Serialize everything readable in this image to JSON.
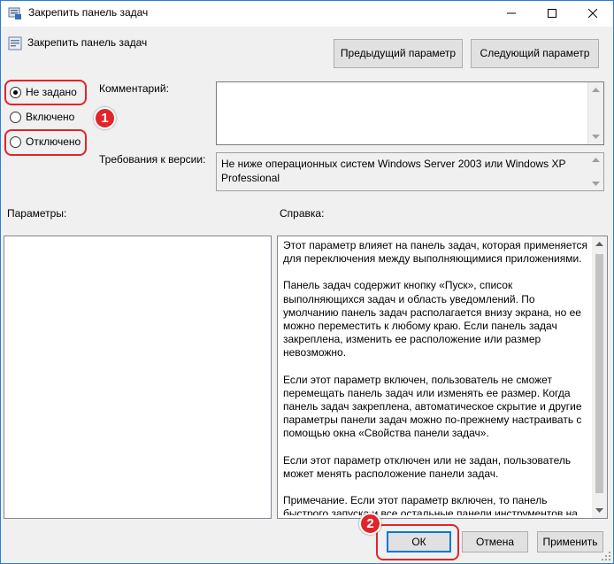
{
  "window": {
    "title": "Закрепить панель задач"
  },
  "header": {
    "policy_name": "Закрепить панель задач",
    "prev_button": "Предыдущий параметр",
    "next_button": "Следующий параметр"
  },
  "state_options": [
    {
      "label": "Не задано",
      "selected": true
    },
    {
      "label": "Включено",
      "selected": false
    },
    {
      "label": "Отключено",
      "selected": false
    }
  ],
  "comment": {
    "label": "Комментарий:",
    "value": ""
  },
  "version": {
    "label": "Требования к версии:",
    "value": "Не ниже операционных систем Windows Server 2003 или Windows XP Professional"
  },
  "params": {
    "label": "Параметры:"
  },
  "help": {
    "label": "Справка:",
    "paragraphs": [
      "Этот параметр влияет на панель задач, которая применяется для переключения между выполняющимися приложениями.",
      "Панель задач содержит кнопку «Пуск», список выполняющихся задач и область уведомлений. По умолчанию панель задач располагается внизу экрана, но ее можно переместить к любому краю. Если панель задач закреплена, изменить ее расположение или размер невозможно.",
      "Если этот параметр включен, пользователь не сможет перемещать панель задач или изменять ее размер. Когда панель задач закреплена, автоматическое скрытие и другие параметры панели задач можно по-прежнему настраивать с помощью окна «Свойства панели задач».",
      "Если этот параметр отключен или не задан, пользователь может менять расположение панели задач.",
      "Примечание. Если этот параметр включен, то панель быстрого запуска и все остальные панели инструментов на"
    ]
  },
  "footer": {
    "ok": "ОК",
    "cancel": "Отмена",
    "apply": "Применить"
  },
  "annotations": {
    "badge1": "1",
    "badge2": "2",
    "color": "#e0252b"
  }
}
